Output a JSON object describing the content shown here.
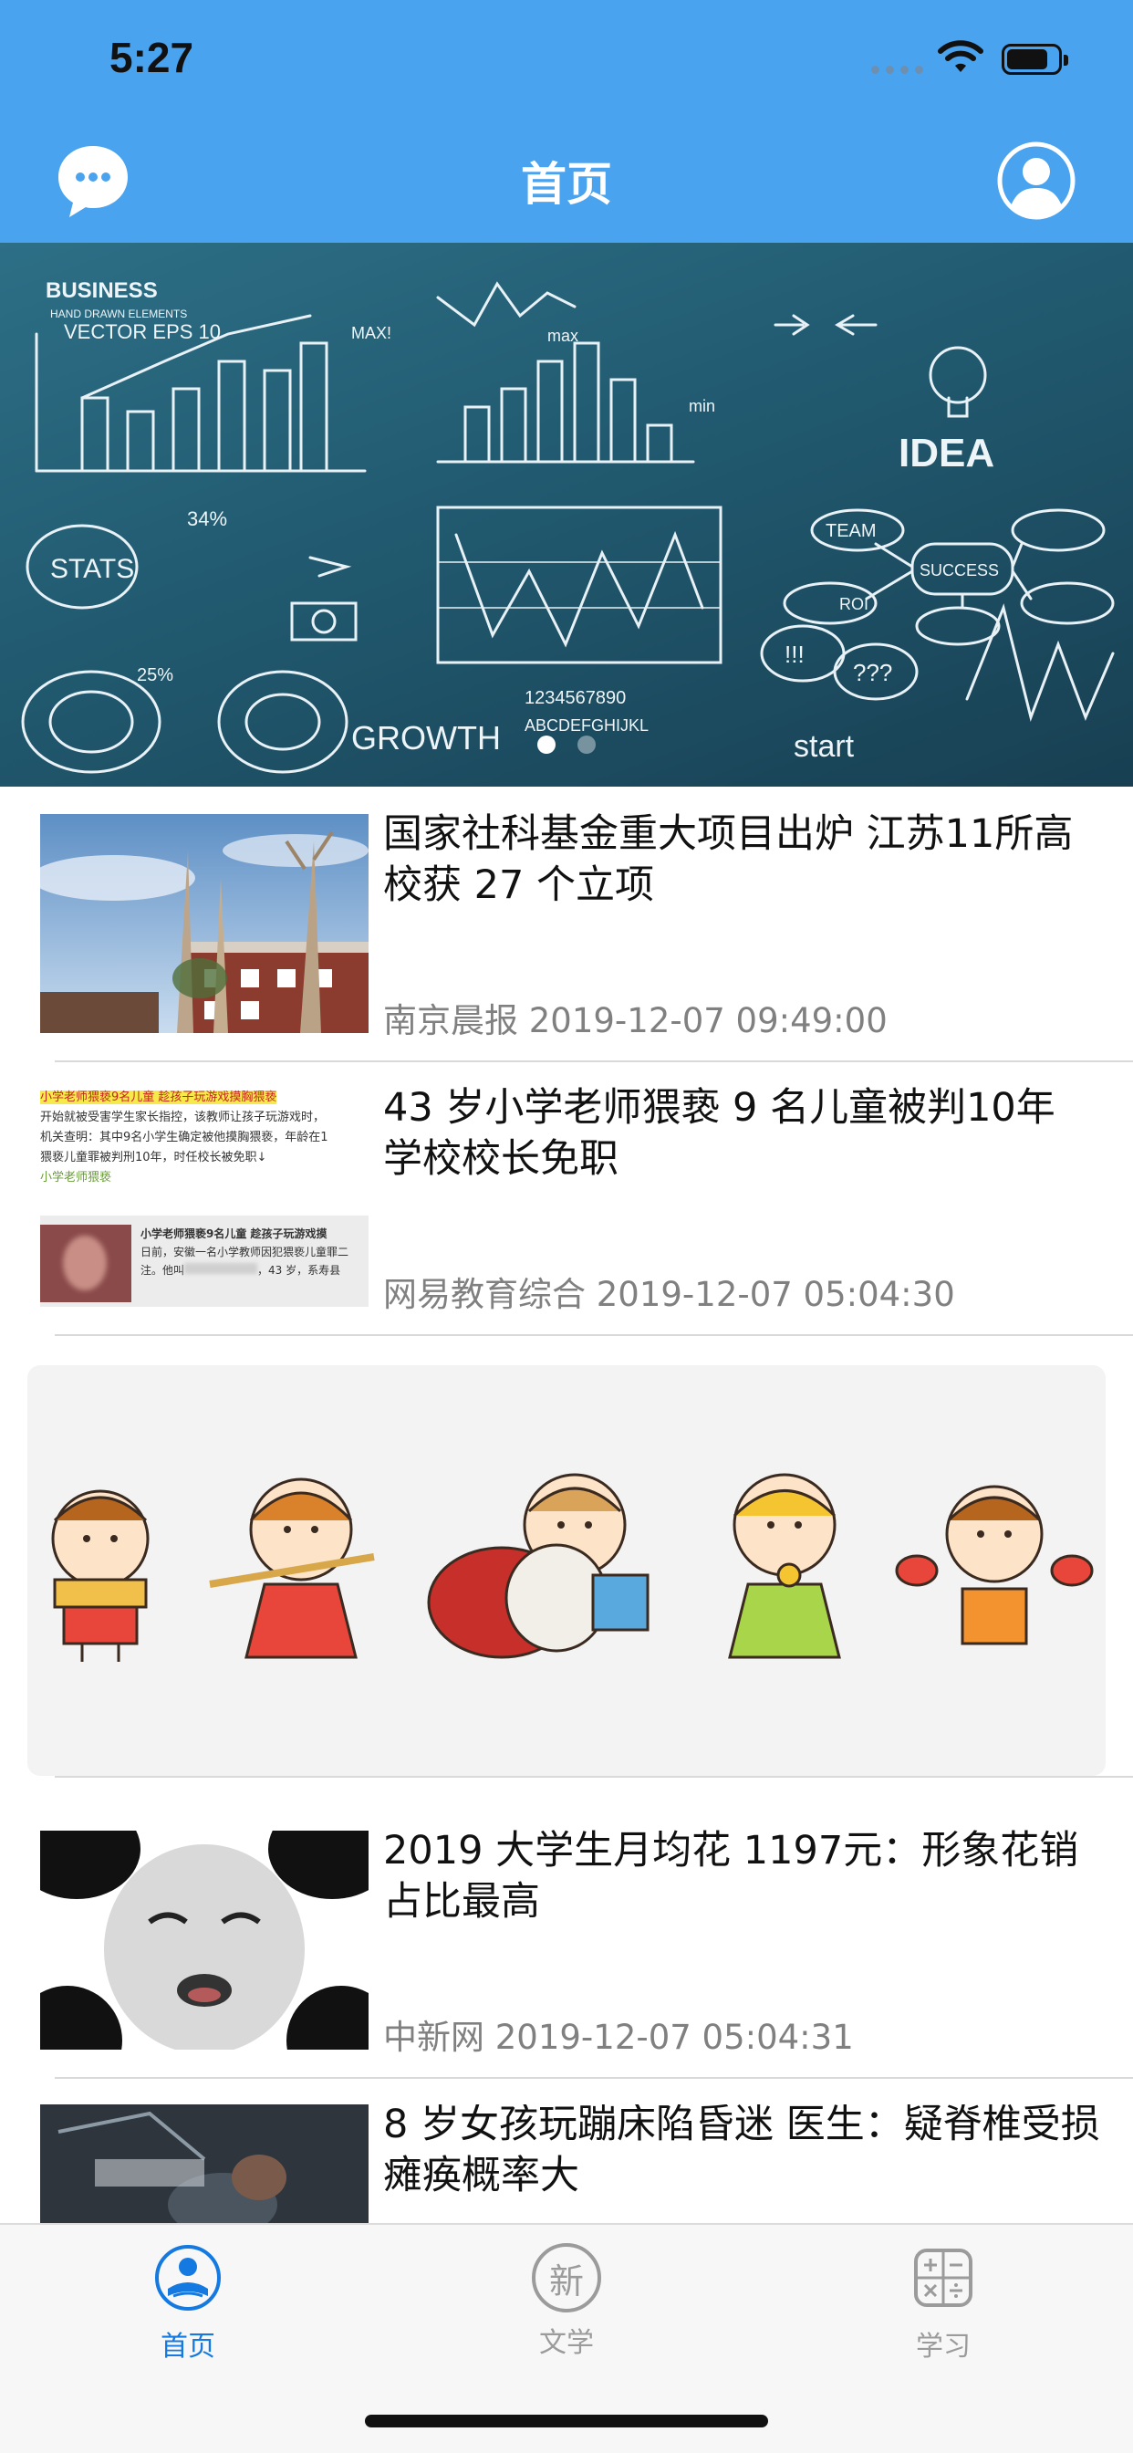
{
  "status_bar": {
    "time": "5:27"
  },
  "nav": {
    "title": "首页",
    "left_icon": "chat-bubble-icon",
    "right_icon": "user-profile-icon"
  },
  "banner": {
    "texts": [
      "BUSINESS",
      "HAND DRAWN ELEMENTS",
      "VECTOR EPS 10",
      "MAX!",
      "max",
      "min",
      "IDEA",
      "TEAM",
      "SUCCESS",
      "STATS",
      "34%",
      "25%",
      "ROI",
      "GROWTH",
      "1234567890",
      "ABCDEFGHIJKL",
      "start",
      "!!!",
      "???"
    ],
    "page_count": 2,
    "active_index": 0
  },
  "news": [
    {
      "title": "国家社科基金重大项目出炉 江苏11所高校获 27 个立项",
      "source": "南京晨报",
      "time": "2019-12-07 09:49:00"
    },
    {
      "title": "43 岁小学老师猥亵 9 名儿童被判10年 学校校长免职",
      "source": "网易教育综合",
      "time": "2019-12-07 05:04:30"
    },
    {
      "title": "2019 大学生月均花 1197元：形象花销占比最高",
      "source": "中新网",
      "time": "2019-12-07 05:04:31"
    },
    {
      "title": "8 岁女孩玩蹦床陷昏迷 医生：疑脊椎受损 瘫痪概率大",
      "source": "",
      "time": ""
    }
  ],
  "thumb2_text": {
    "headline": "小学老师猥亵9名儿童 趁孩子玩游戏摸胸猥亵",
    "line1": "开始就被受害学生家长指控，该教师让孩子玩游戏时，",
    "line2": "机关查明：其中9名小学生确定被他摸胸猥亵，年龄在1",
    "line3": "猥亵儿童罪被判刑10年，时任校长被免职↓",
    "tag": "小学老师猥亵",
    "card_title": "小学老师猥亵9名儿童 趁孩子玩游戏摸",
    "card_body": "日前，安徽一名小学教师因犯猥亵儿童罪二",
    "card_body2": "注。他叫",
    "card_body3": "，43 岁，系寿县"
  },
  "tabs": [
    {
      "label": "首页",
      "icon": "reader-home-icon",
      "active": true
    },
    {
      "label": "文学",
      "icon": "xin-circle-icon",
      "active": false,
      "glyph": "新"
    },
    {
      "label": "学习",
      "icon": "calculator-icon",
      "active": false
    }
  ]
}
